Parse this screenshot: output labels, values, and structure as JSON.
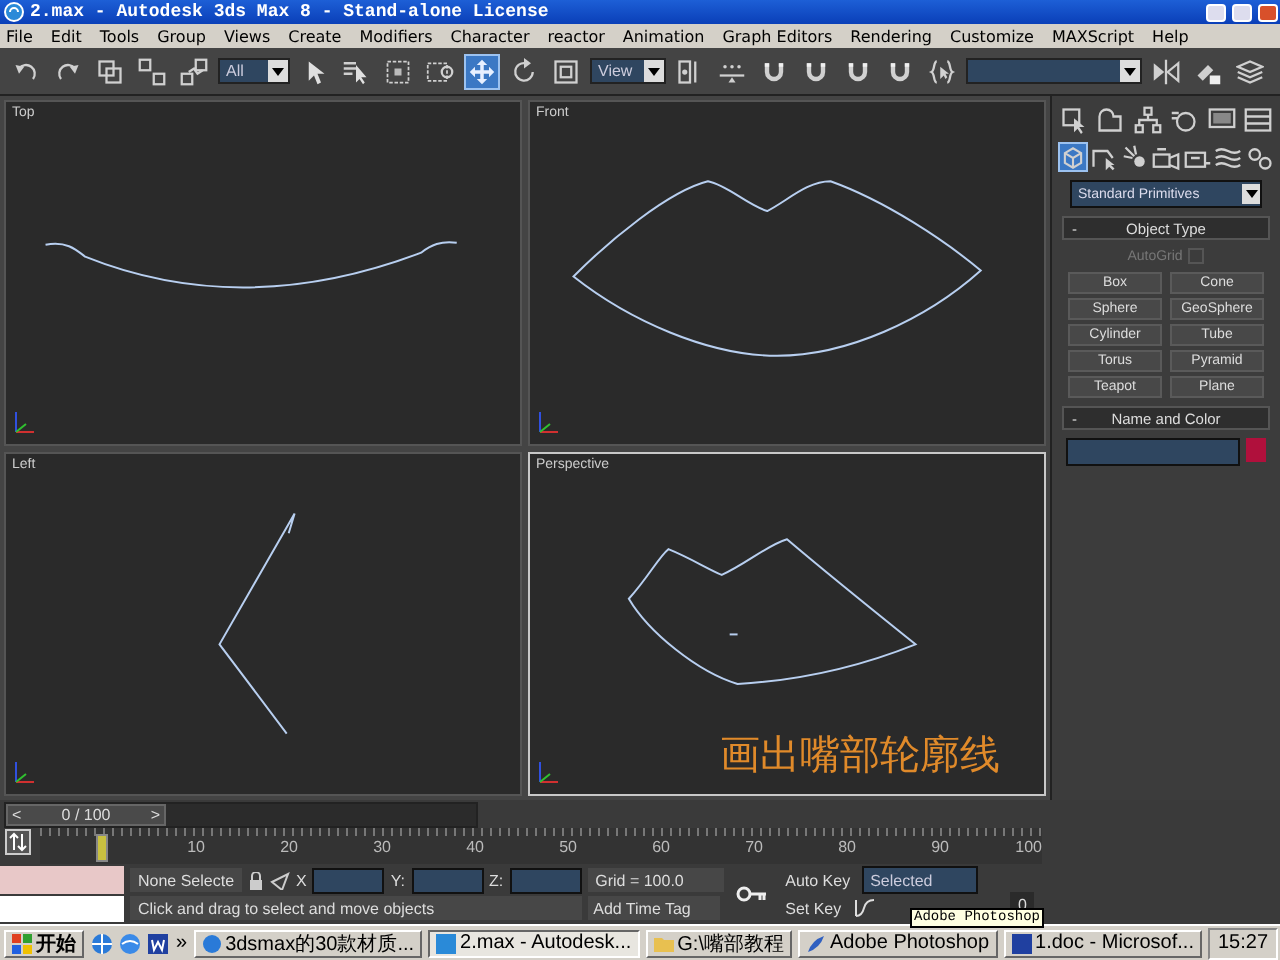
{
  "window": {
    "title": "2.max - Autodesk 3ds Max 8  - Stand-alone License"
  },
  "menu": [
    "File",
    "Edit",
    "Tools",
    "Group",
    "Views",
    "Create",
    "Modifiers",
    "Character",
    "reactor",
    "Animation",
    "Graph Editors",
    "Rendering",
    "Customize",
    "MAXScript",
    "Help"
  ],
  "toolbar": [
    {
      "kind": "undo",
      "selected": false
    },
    {
      "kind": "redo",
      "selected": false
    },
    {
      "kind": "link",
      "selected": false
    },
    {
      "kind": "unlink",
      "selected": false
    },
    {
      "kind": "bind",
      "selected": false
    },
    {
      "kind": "dropdown",
      "value": "All"
    },
    {
      "kind": "select",
      "selected": false
    },
    {
      "kind": "select_name",
      "selected": false
    },
    {
      "kind": "region",
      "selected": false
    },
    {
      "kind": "crossing",
      "selected": false
    },
    {
      "kind": "move",
      "selected": true
    },
    {
      "kind": "rotate",
      "selected": false
    },
    {
      "kind": "scale",
      "selected": false
    },
    {
      "kind": "dropdown",
      "value": "View"
    },
    {
      "kind": "pivot",
      "selected": false
    },
    {
      "kind": "manipulate",
      "selected": false
    },
    {
      "kind": "snap",
      "selected": false
    },
    {
      "kind": "snap",
      "selected": false
    },
    {
      "kind": "snap",
      "selected": false
    },
    {
      "kind": "snap",
      "selected": false
    },
    {
      "kind": "braces",
      "selected": false
    },
    {
      "kind": "dropdown"
    },
    {
      "kind": "mirror",
      "selected": false
    },
    {
      "kind": "align",
      "selected": false
    },
    {
      "kind": "layers",
      "selected": false
    }
  ],
  "viewports": [
    {
      "label": "Top",
      "kind": "top",
      "active": false
    },
    {
      "label": "Front",
      "kind": "front",
      "active": false
    },
    {
      "label": "Left",
      "kind": "left",
      "active": false
    },
    {
      "label": "Perspective",
      "kind": "perspective",
      "active": true,
      "caption": "画出嘴部轮廓线"
    }
  ],
  "command_panel": {
    "tabs": [
      {
        "kind": "create",
        "selected": false
      },
      {
        "kind": "modify",
        "selected": false
      },
      {
        "kind": "hierarchy",
        "selected": false
      },
      {
        "kind": "motion",
        "selected": false
      },
      {
        "kind": "display",
        "selected": false
      },
      {
        "kind": "utilities",
        "selected": false
      }
    ],
    "categories": [
      {
        "kind": "geometry",
        "selected": true
      },
      {
        "kind": "shapes",
        "selected": false
      },
      {
        "kind": "lights",
        "selected": false
      },
      {
        "kind": "cameras",
        "selected": false
      },
      {
        "kind": "helpers",
        "selected": false
      },
      {
        "kind": "spacewarps",
        "selected": false
      },
      {
        "kind": "systems",
        "selected": false
      }
    ],
    "object_class": "Standard Primitives",
    "object_type": {
      "sign": "-",
      "title": "Object Type",
      "autogrid": {
        "label": "AutoGrid",
        "checked": false,
        "disabled": true
      },
      "buttons": [
        "Box",
        "Cone",
        "Sphere",
        "GeoSphere",
        "Cylinder",
        "Tube",
        "Torus",
        "Pyramid",
        "Teapot",
        "Plane"
      ]
    },
    "name_and_color": {
      "sign": "-",
      "title": "Name and Color",
      "color": "#b0103c"
    }
  },
  "timeline": {
    "prev": "<",
    "position": "0 / 100",
    "next": ">",
    "level": 0
  },
  "trackbar": {
    "ticks": [
      "10",
      "20",
      "30",
      "40",
      "50",
      "60",
      "70",
      "80",
      "90",
      "100"
    ]
  },
  "status": {
    "selection": "None Selecte",
    "axes": [
      "X",
      "Y:",
      "Z:"
    ],
    "grid": "Grid = 100.0",
    "add_time_tag": "Add Time Tag",
    "prompt": "Click and drag to select and move objects",
    "auto_key": "Auto Key",
    "key_mode": "Selected",
    "set_key": "Set Key",
    "frame": "0",
    "tooltip": "Adobe Photoshop"
  },
  "taskbar": {
    "start": "开始",
    "more": "»",
    "items": [
      {
        "label": "3dsmax的30款材质...",
        "kind": "browser",
        "selected": false
      },
      {
        "label": "2.max - Autodesk...",
        "kind": "max",
        "selected": true
      },
      {
        "label": "G:\\嘴部教程",
        "kind": "folder",
        "selected": false
      },
      {
        "label": "Adobe Photoshop",
        "kind": "photoshop",
        "selected": false
      },
      {
        "label": "1.doc - Microsof...",
        "kind": "word",
        "selected": false
      }
    ],
    "clock": "15:27"
  }
}
